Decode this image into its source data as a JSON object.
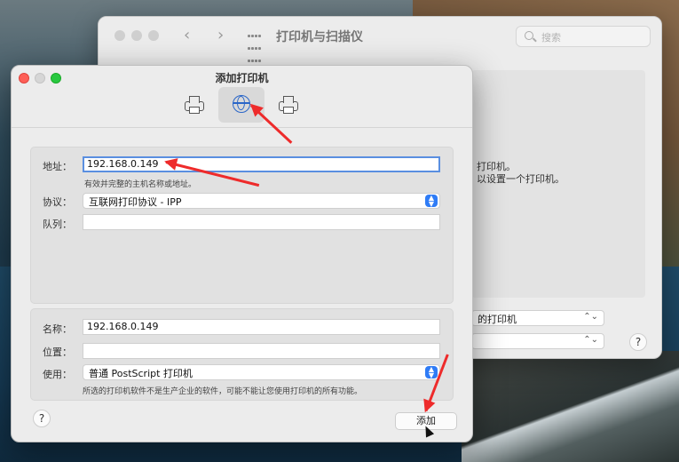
{
  "back_window": {
    "title": "打印机与扫描仪",
    "search_placeholder": "搜索",
    "nav_back": "‹",
    "nav_forward": "›",
    "message_line1": "打印机。",
    "message_line2": "以设置一个打印机。",
    "default_printer_select": "的打印机",
    "paper_select": "",
    "help_label": "?"
  },
  "sheet": {
    "title": "添加打印机",
    "tabs": [
      {
        "name": "default",
        "icon": "printer-icon",
        "active": false
      },
      {
        "name": "ip",
        "icon": "globe-icon",
        "active": true
      },
      {
        "name": "windows",
        "icon": "printer-icon",
        "active": false
      }
    ],
    "address": {
      "label": "地址：",
      "value": "192.168.0.149",
      "hint": "有效并完整的主机名称或地址。"
    },
    "protocol": {
      "label": "协议：",
      "value": "互联网打印协议 - IPP"
    },
    "queue": {
      "label": "队列：",
      "value": ""
    },
    "name": {
      "label": "名称：",
      "value": "192.168.0.149"
    },
    "location": {
      "label": "位置：",
      "value": ""
    },
    "use": {
      "label": "使用：",
      "value": "普通 PostScript 打印机",
      "hint": "所选的打印机软件不是生产企业的软件，可能不能让您使用打印机的所有功能。"
    },
    "help_label": "?",
    "add_button": "添加"
  },
  "colors": {
    "annotation_arrow": "#ee2b2b",
    "accent": "#2f7cf6",
    "close": "#fe5f57",
    "zoom": "#28c840"
  }
}
